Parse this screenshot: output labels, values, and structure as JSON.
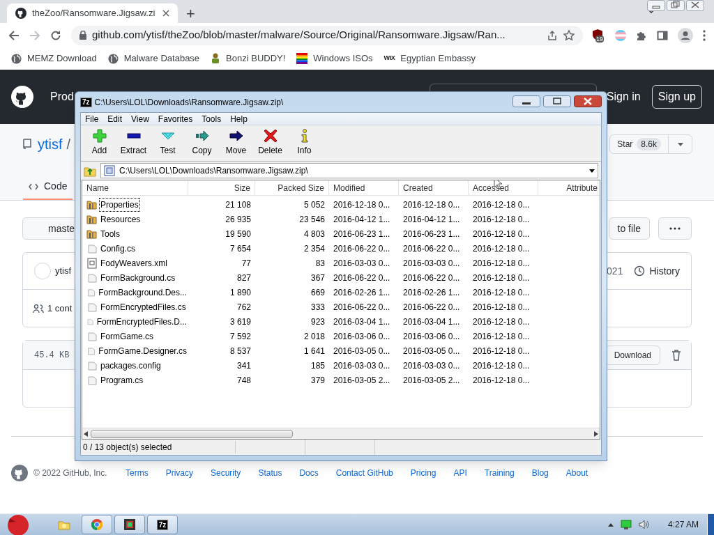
{
  "browser": {
    "tab": {
      "title": "theZoo/Ransomware.Jigsaw.zi"
    },
    "new_tab": "+",
    "address": "github.com/ytisf/theZoo/blob/master/malware/Source/Original/Ransomware.Jigsaw/Ran...",
    "extension_badge": "19",
    "bookmarks": [
      {
        "label": "MEMZ Download",
        "kind": "globe"
      },
      {
        "label": "Malware Database",
        "kind": "globe"
      },
      {
        "label": "Bonzi BUDDY!",
        "kind": "figure"
      },
      {
        "label": "Windows ISOs",
        "kind": "flag"
      },
      {
        "label": "Egyptian Embassy",
        "kind": "wordmark",
        "favicon_text": "WIX"
      }
    ]
  },
  "github": {
    "header": {
      "nav_item": "Prod",
      "sign_in": "Sign in",
      "sign_up": "Sign up"
    },
    "repo": {
      "owner": "ytisf",
      "separator": "/",
      "star_label": "Star",
      "star_count": "8.6k"
    },
    "tabs": [
      {
        "label": "Code",
        "selected": true
      }
    ],
    "branch_button": "maste",
    "go_to_file_button": "to file",
    "commit": {
      "author": "ytisf",
      "date": "021",
      "history": "History",
      "contributors": "1 cont"
    },
    "file": {
      "size": "45.4 KB",
      "download": "Download"
    },
    "footer": {
      "copyright": "© 2022 GitHub, Inc.",
      "links": [
        "Terms",
        "Privacy",
        "Security",
        "Status",
        "Docs",
        "Contact GitHub",
        "Pricing",
        "API",
        "Training",
        "Blog",
        "About"
      ]
    }
  },
  "archive_window": {
    "app_icon_text": "7z",
    "title": "C:\\Users\\LOL\\Downloads\\Ransomware.Jigsaw.zip\\",
    "menu": [
      "File",
      "Edit",
      "View",
      "Favorites",
      "Tools",
      "Help"
    ],
    "toolbar": [
      {
        "label": "Add",
        "kind": "add"
      },
      {
        "label": "Extract",
        "kind": "extract"
      },
      {
        "label": "Test",
        "kind": "test"
      },
      {
        "label": "Copy",
        "kind": "copy"
      },
      {
        "label": "Move",
        "kind": "move"
      },
      {
        "label": "Delete",
        "kind": "delete"
      },
      {
        "label": "Info",
        "kind": "info"
      }
    ],
    "path": "C:\\Users\\LOL\\Downloads\\Ransomware.Jigsaw.zip\\",
    "columns": [
      "Name",
      "Size",
      "Packed Size",
      "Modified",
      "Created",
      "Accessed",
      "Attribute"
    ],
    "rows": [
      {
        "kind": "folder",
        "focused": true,
        "cells": [
          "Properties",
          "21 108",
          "5 052",
          "2016-12-18 0...",
          "2016-12-18 0...",
          "2016-12-18 0..."
        ]
      },
      {
        "kind": "folder",
        "focused": false,
        "cells": [
          "Resources",
          "26 935",
          "23 546",
          "2016-04-12 1...",
          "2016-04-12 1...",
          "2016-12-18 0..."
        ]
      },
      {
        "kind": "folder",
        "focused": false,
        "cells": [
          "Tools",
          "19 590",
          "4 803",
          "2016-06-23 1...",
          "2016-06-23 1...",
          "2016-12-18 0..."
        ]
      },
      {
        "kind": "file",
        "focused": false,
        "cells": [
          "Config.cs",
          "7 654",
          "2 354",
          "2016-06-22 0...",
          "2016-06-22 0...",
          "2016-12-18 0..."
        ]
      },
      {
        "kind": "xml",
        "focused": false,
        "cells": [
          "FodyWeavers.xml",
          "77",
          "83",
          "2016-03-03 0...",
          "2016-03-03 0...",
          "2016-12-18 0..."
        ]
      },
      {
        "kind": "file",
        "focused": false,
        "cells": [
          "FormBackground.cs",
          "827",
          "367",
          "2016-06-22 0...",
          "2016-06-22 0...",
          "2016-12-18 0..."
        ]
      },
      {
        "kind": "file",
        "focused": false,
        "cells": [
          "FormBackground.Des...",
          "1 890",
          "669",
          "2016-02-26 1...",
          "2016-02-26 1...",
          "2016-12-18 0..."
        ]
      },
      {
        "kind": "file",
        "focused": false,
        "cells": [
          "FormEncryptedFiles.cs",
          "762",
          "333",
          "2016-06-22 0...",
          "2016-06-22 0...",
          "2016-12-18 0..."
        ]
      },
      {
        "kind": "file",
        "focused": false,
        "cells": [
          "FormEncryptedFiles.D...",
          "3 619",
          "923",
          "2016-03-04 1...",
          "2016-03-04 1...",
          "2016-12-18 0..."
        ]
      },
      {
        "kind": "file",
        "focused": false,
        "cells": [
          "FormGame.cs",
          "7 592",
          "2 018",
          "2016-03-06 0...",
          "2016-03-06 0...",
          "2016-12-18 0..."
        ]
      },
      {
        "kind": "file",
        "focused": false,
        "cells": [
          "FormGame.Designer.cs",
          "8 537",
          "1 641",
          "2016-03-05 0...",
          "2016-03-05 0...",
          "2016-12-18 0..."
        ]
      },
      {
        "kind": "file",
        "focused": false,
        "cells": [
          "packages.config",
          "341",
          "185",
          "2016-03-03 0...",
          "2016-03-03 0...",
          "2016-12-18 0..."
        ]
      },
      {
        "kind": "file",
        "focused": false,
        "cells": [
          "Program.cs",
          "748",
          "379",
          "2016-03-05 2...",
          "2016-03-05 2...",
          "2016-12-18 0..."
        ]
      }
    ],
    "status": "0 / 13 object(s) selected"
  },
  "taskbar": {
    "apps": [
      {
        "kind": "folder"
      },
      {
        "kind": "chrome"
      },
      {
        "kind": "app"
      },
      {
        "kind": "archiver",
        "label": "7z"
      }
    ],
    "clock": "4:27 AM"
  }
}
